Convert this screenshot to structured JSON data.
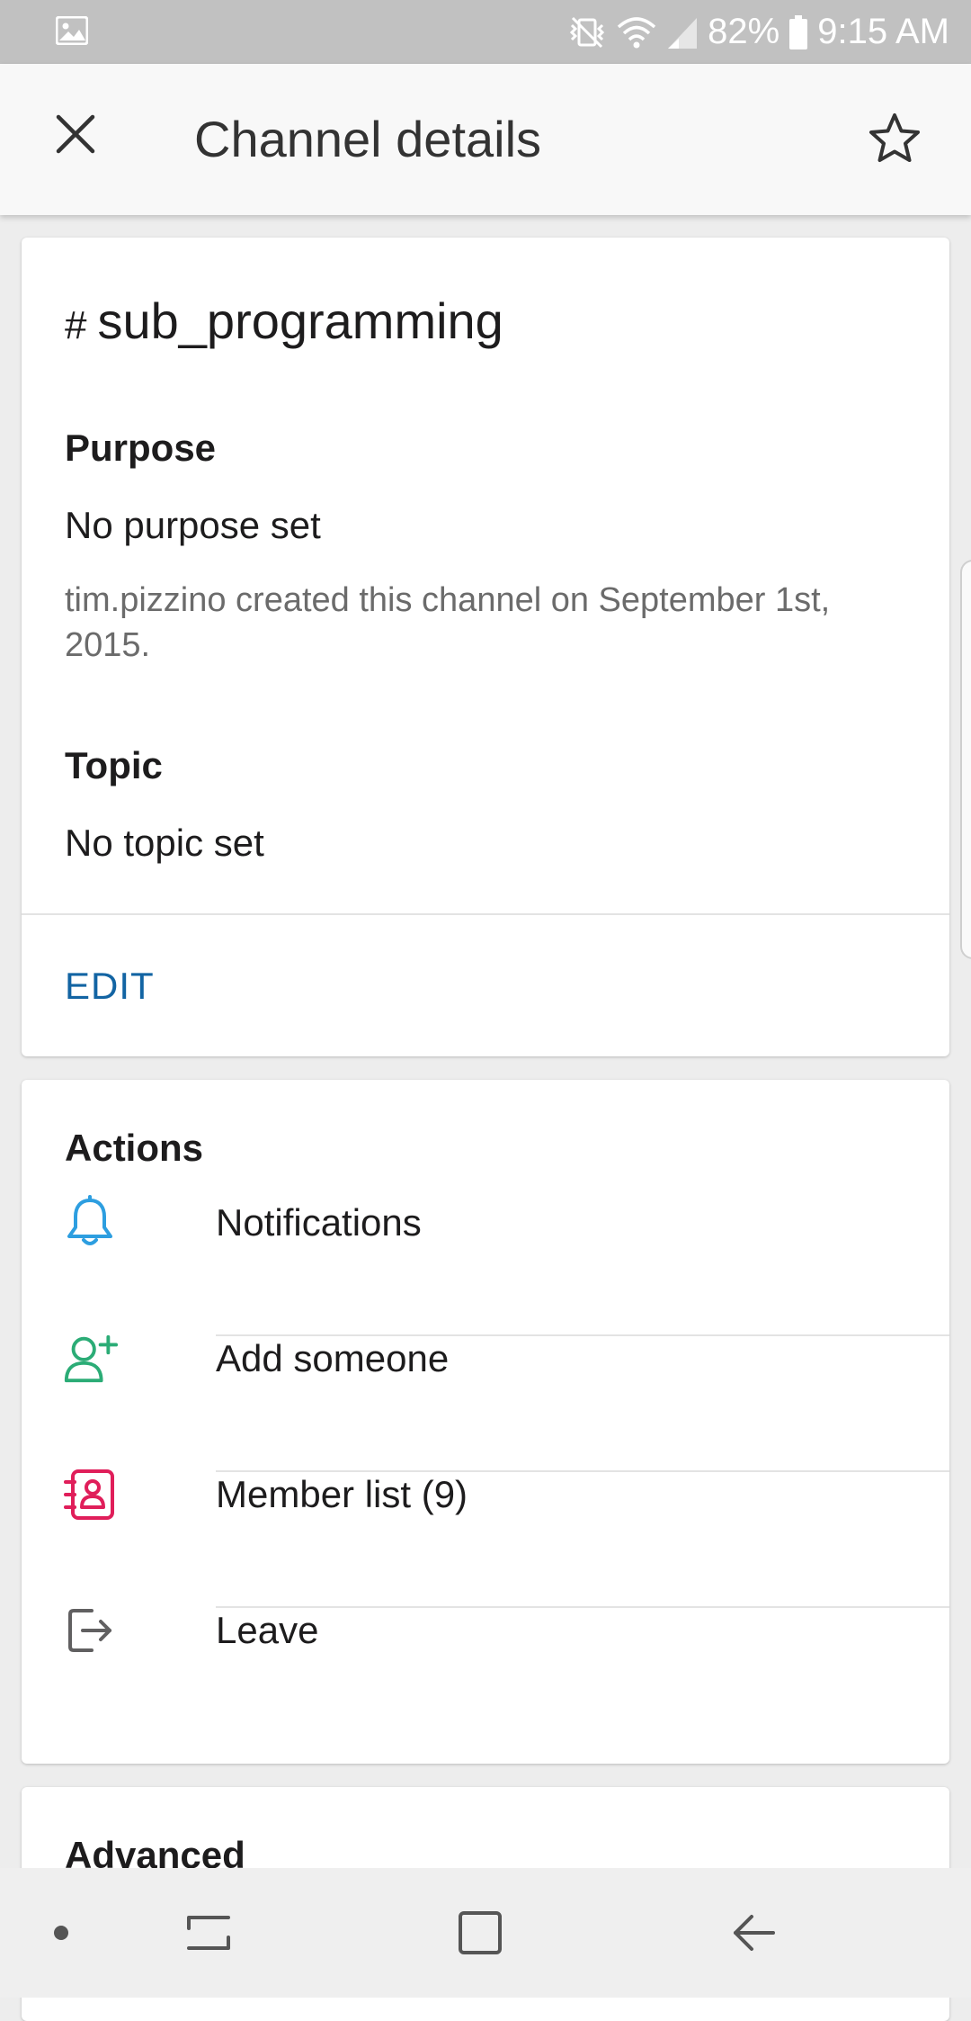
{
  "status_bar": {
    "battery": "82%",
    "time": "9:15 AM",
    "icons": [
      "gallery-notification-icon",
      "vibrate-off-icon",
      "wifi-icon",
      "signal-icon",
      "battery-icon"
    ]
  },
  "app_bar": {
    "title": "Channel details",
    "close_icon": "close-icon",
    "star_icon": "star-icon"
  },
  "details": {
    "hash": "#",
    "channel_name": "sub_programming",
    "purpose_label": "Purpose",
    "purpose_value": "No purpose set",
    "created_note": "tim.pizzino created this channel on September 1st, 2015.",
    "topic_label": "Topic",
    "topic_value": "No topic set",
    "edit_label": "EDIT",
    "edit_color": "#1264a3"
  },
  "actions": {
    "title": "Actions",
    "items": [
      {
        "label": "Notifications",
        "icon": "bell-icon",
        "color": "#2d9ee0"
      },
      {
        "label": "Add someone",
        "icon": "add-user-icon",
        "color": "#2bac76"
      },
      {
        "label": "Member list (9)",
        "icon": "member-list-icon",
        "color": "#e01e5a"
      },
      {
        "label": "Leave",
        "icon": "leave-icon",
        "color": "#616061"
      }
    ]
  },
  "advanced": {
    "title": "Advanced"
  },
  "nav_bar": {
    "icons": [
      "nav-dot-icon",
      "recents-icon",
      "home-icon",
      "back-icon"
    ]
  }
}
